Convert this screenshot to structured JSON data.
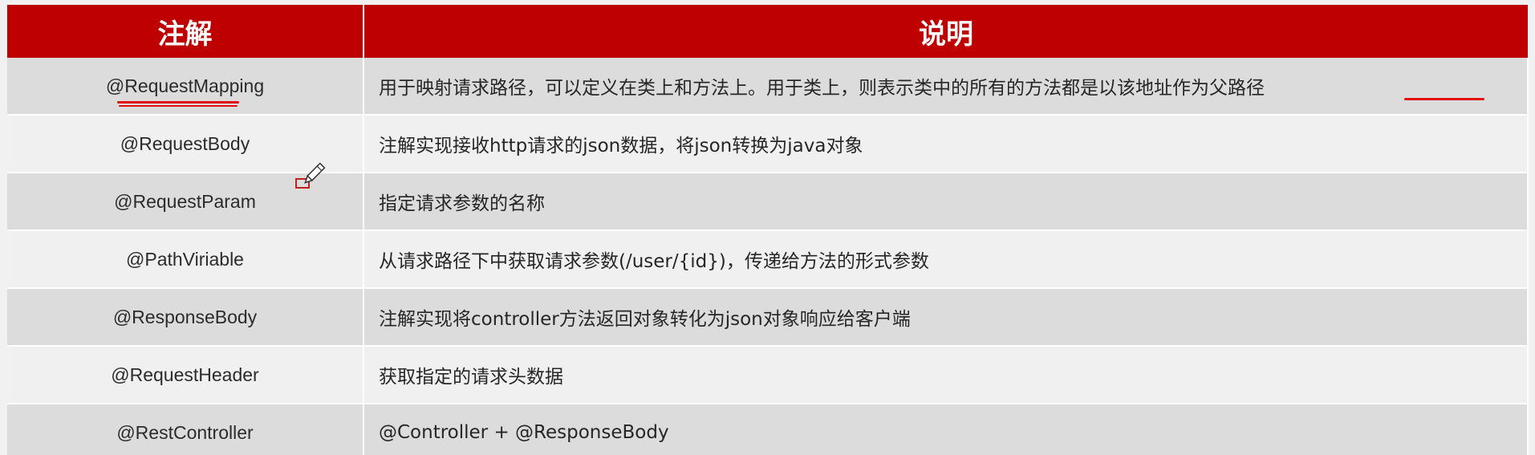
{
  "table": {
    "headers": [
      "注解",
      "说明"
    ],
    "rows": [
      {
        "annotation": "@RequestMapping",
        "description": "用于映射请求路径，可以定义在类上和方法上。用于类上，则表示类中的所有的方法都是以该地址作为父路径"
      },
      {
        "annotation": "@RequestBody",
        "description": "注解实现接收http请求的json数据，将json转换为java对象"
      },
      {
        "annotation": "@RequestParam",
        "description": "指定请求参数的名称"
      },
      {
        "annotation": "@PathViriable",
        "description": "从请求路径下中获取请求参数(/user/{id})，传递给方法的形式参数"
      },
      {
        "annotation": "@ResponseBody",
        "description": "注解实现将controller方法返回对象转化为json对象响应给客户端"
      },
      {
        "annotation": "@RequestHeader",
        "description": "获取指定的请求头数据"
      },
      {
        "annotation": "@RestController",
        "description": "@Controller + @ResponseBody"
      }
    ]
  },
  "colors": {
    "header_bg": "#bf0000",
    "header_text": "#ffffff",
    "row_odd": "#dcdcdc",
    "row_even": "#f0f0f0",
    "highlight": "#e01010"
  },
  "icons": [
    "pencil-cursor-icon"
  ]
}
